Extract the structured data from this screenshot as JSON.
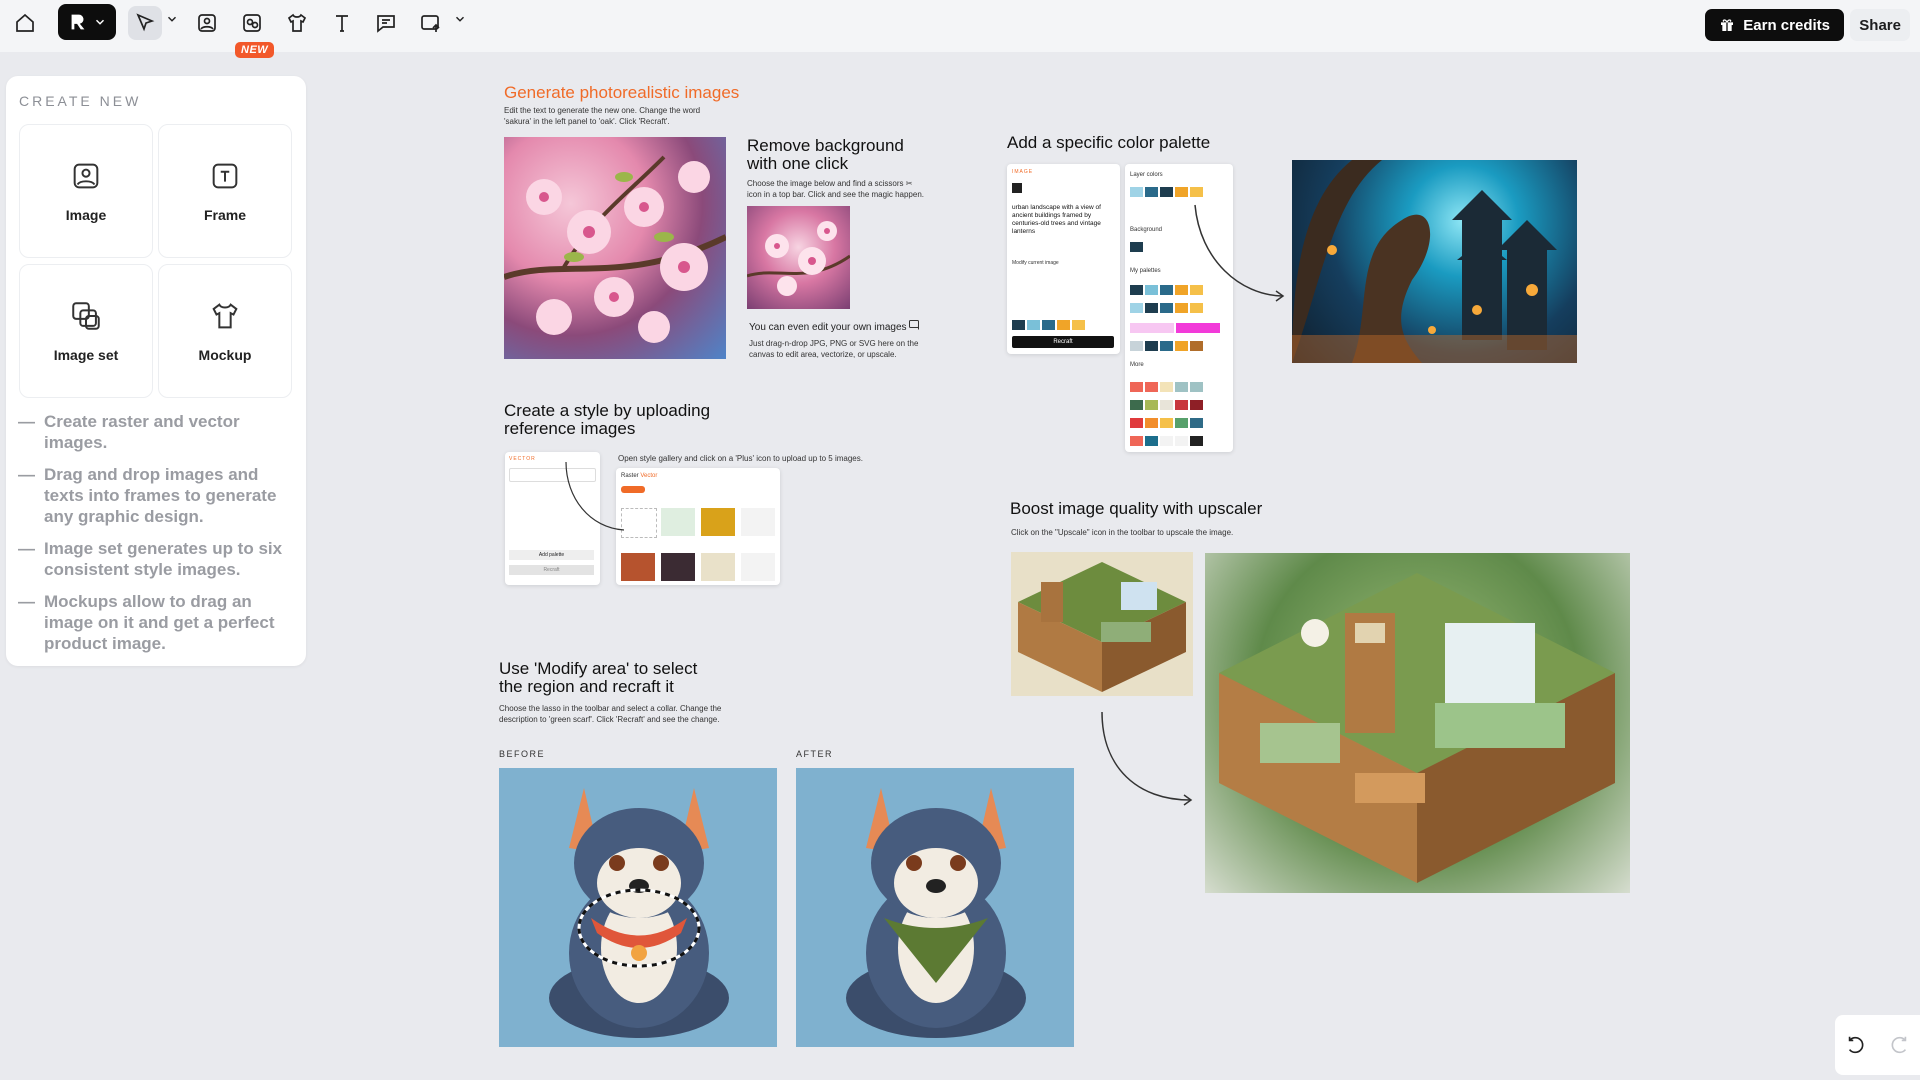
{
  "toolbar": {
    "new_badge": "NEW",
    "earn_credits": "Earn credits",
    "share": "Share"
  },
  "panel": {
    "title": "CREATE NEW",
    "cards": [
      "Image",
      "Frame",
      "Image set",
      "Mockup"
    ],
    "tips": [
      "Create raster and vector images.",
      "Drag and drop images and texts into frames to generate any graphic design.",
      "Image set generates up to six consistent style images.",
      "Mockups allow to drag an image on it and get a perfect product image."
    ]
  },
  "canvas": {
    "photoreal": {
      "title": "Generate photorealistic images",
      "desc": "Edit the text to generate the new one. Change the word 'sakura' in the left panel to 'oak'. Click 'Recraft'."
    },
    "remove_bg": {
      "title": "Remove background with one click",
      "desc": "Choose the image below and find a scissors ✂ icon in a top bar. Click and see the magic happen.",
      "edit_title": "You can even edit your own images",
      "edit_desc": "Just drag-n-drop JPG, PNG or SVG here on the canvas to edit area, vectorize, or upscale."
    },
    "palette": {
      "title": "Add a specific color palette",
      "mock_prompt": "urban landscape with a view of ancient buildings framed by centuries-old trees and vintage lanterns",
      "mock_modify": "Modify current image",
      "mock_button": "Recraft",
      "mock_layer": "Layer colors",
      "mock_background": "Background",
      "mock_my_palettes": "My palettes",
      "mock_more": "More"
    },
    "style": {
      "title": "Create a style by uploading reference images",
      "desc": "Open style gallery and click on a 'Plus' icon to upload up to 5 images.",
      "mock_add_palette": "Add palette",
      "mock_recraft": "Recraft",
      "mock_raster": "Raster",
      "mock_vector": "Vector"
    },
    "upscale": {
      "title": "Boost image quality with upscaler",
      "desc": "Click on the \"Upscale\" icon in the toolbar to upscale the image."
    },
    "modify": {
      "title": "Use 'Modify area' to select the region  and recraft it",
      "desc": "Choose the lasso in the toolbar and select a collar. Change the description to 'green scarf'. Click 'Recraft' and see the change.",
      "before": "BEFORE",
      "after": "AFTER"
    }
  },
  "colors": {
    "accent_orange": "#f06b28",
    "badge": "#f2582a",
    "dark": "#0d0d0d",
    "canvas_bg": "#e9eaee"
  }
}
